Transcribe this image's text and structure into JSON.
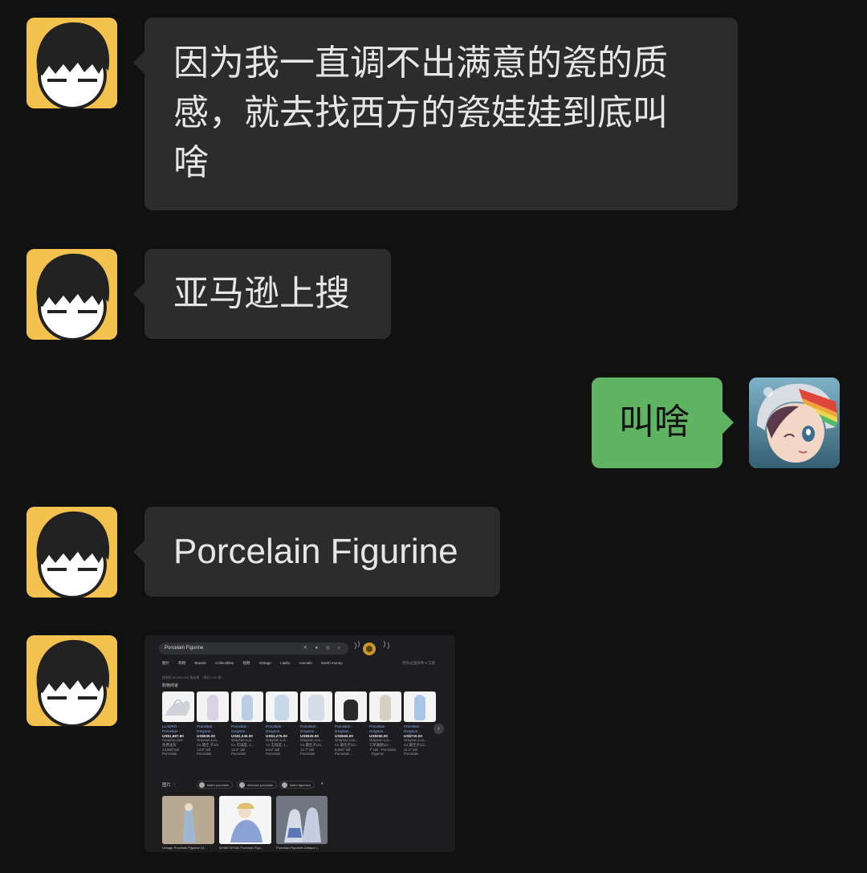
{
  "colors": {
    "background": "#111111",
    "bubble_left": "#2c2c2c",
    "bubble_right": "#5fb362",
    "avatar_bg": "#f3c24e"
  },
  "messages": [
    {
      "side": "left",
      "avatar": "cartoon-avatar",
      "lines": [
        "因为我一直调不出满意的瓷的质",
        "感，就去找西方的瓷娃娃到底叫",
        "啥"
      ]
    },
    {
      "side": "left",
      "avatar": "cartoon-avatar",
      "text": "亚马逊上搜"
    },
    {
      "side": "right",
      "avatar": "anime-girl-helmet-avatar",
      "text": "叫啥"
    },
    {
      "side": "left",
      "avatar": "cartoon-avatar",
      "text": "Porcelain Figurine"
    },
    {
      "side": "left",
      "avatar": "cartoon-avatar",
      "type": "image"
    }
  ],
  "screenshot": {
    "search_query": "Porcelain Figurine",
    "tabs": [
      "图片",
      "购物",
      "Brands",
      "Collectibles",
      "视频",
      "Vintage",
      "Lladro",
      "Animals",
      "Worth money"
    ],
    "tabs_right": "所有过滤条件  ▾    工具",
    "result_count": "找到约 32,800,000 条结果 （用时 0.47 秒）",
    "shopping_title": "购物商家",
    "products": [
      {
        "title": "LLADRO - Porcelain -",
        "price": "US$1,687.80",
        "store": "Amazon.com",
        "note": "免费送货",
        "size": "14,580\"tall",
        "desc": "Porcelain"
      },
      {
        "title": "Porcelain - Grayson...",
        "price": "US$635.00",
        "store": "Grayson Lux...",
        "note": "Cs 最佳 子1/2",
        "size": "14.0\" tall",
        "desc": "Porcelain"
      },
      {
        "title": "Porcelain - Grayson...",
        "price": "US$2,245.00",
        "store": "Grayson Lux...",
        "note": "Cs 忠诚度, 1...",
        "size": "12.2\" tall",
        "desc": "Porcelain"
      },
      {
        "title": "Porcelain - Grayson...",
        "price": "US$3,275.00",
        "store": "Grayson Lux...",
        "note": "Cs 忠诚度, 1...",
        "size": "24.0\" tall",
        "desc": "Porcelain"
      },
      {
        "title": "Porcelain - Grayson...",
        "price": "US$625.00",
        "store": "Grayson Lux...",
        "note": "Cs 最佳子1/2...",
        "size": "12.7\" tall",
        "desc": "Porcelain"
      },
      {
        "title": "Porcelain - Grayson...",
        "price": "US$565.00",
        "store": "Grayson Lux...",
        "note": "Cs 最佳子1/2...",
        "size": "8,500\" tall",
        "desc": "Porcelain..."
      },
      {
        "title": "Porcelain - Grayson...",
        "price": "US$250.00",
        "store": "Grayson Lux...",
        "note": "订单满额1/2...",
        "size": "7\" tall · Porcelain",
        "desc": "· Figurine"
      },
      {
        "title": "Porcelain - Grayson...",
        "price": "US$710.00",
        "store": "Grayson Lux...",
        "note": "Cs 最佳子1/2...",
        "size": "11.4\" tall",
        "desc": "Porcelain"
      }
    ],
    "images_header": "图片",
    "chips": [
      "lladro porcelain",
      "meissen porcelain",
      "lladro figurines"
    ],
    "gallery": [
      {
        "caption": "Vintage Porcelain Figurine Ol..."
      },
      {
        "caption": "MYME MYME Porcelain Figu..."
      },
      {
        "caption": "Porcelain Figurines Antique |..."
      }
    ]
  }
}
